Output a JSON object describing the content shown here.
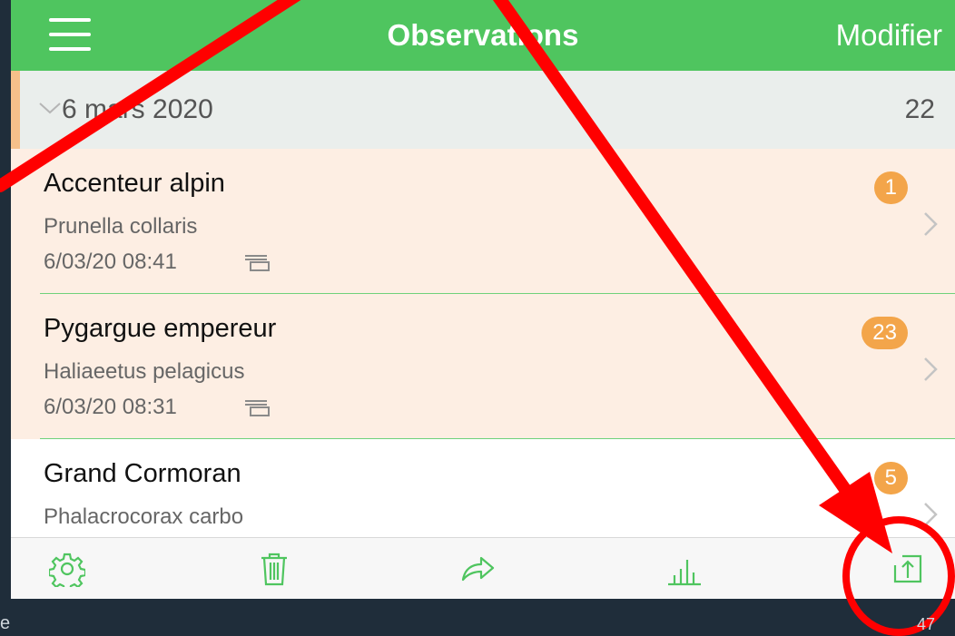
{
  "navbar": {
    "title": "Observations",
    "edit_label": "Modifier",
    "color": "#4fc55f"
  },
  "section": {
    "date": "6 mars 2020",
    "count": "22"
  },
  "observations": [
    {
      "name": "Accenteur alpin",
      "latin": "Prunella collaris",
      "datetime": "6/03/20 08:41",
      "count": "1",
      "highlighted": true,
      "has_multi_icon": true
    },
    {
      "name": "Pygargue empereur",
      "latin": "Haliaeetus pelagicus",
      "datetime": "6/03/20 08:31",
      "count": "23",
      "highlighted": true,
      "has_multi_icon": true
    },
    {
      "name": "Grand Cormoran",
      "latin": "Phalacrocorax carbo",
      "datetime": "",
      "count": "5",
      "highlighted": false,
      "has_multi_icon": false
    }
  ],
  "toolbar": {
    "icons": [
      "gear-icon",
      "trash-icon",
      "share-arrow-icon",
      "chart-icon",
      "export-icon"
    ]
  },
  "colors": {
    "accent_green": "#4fc55f",
    "badge_orange": "#f3a54a",
    "row_highlight": "#fdeee3",
    "annotation_red": "#ff0000",
    "slide_background": "#1f2d3a"
  },
  "slide": {
    "footer_text": "e",
    "page_number": "47"
  }
}
